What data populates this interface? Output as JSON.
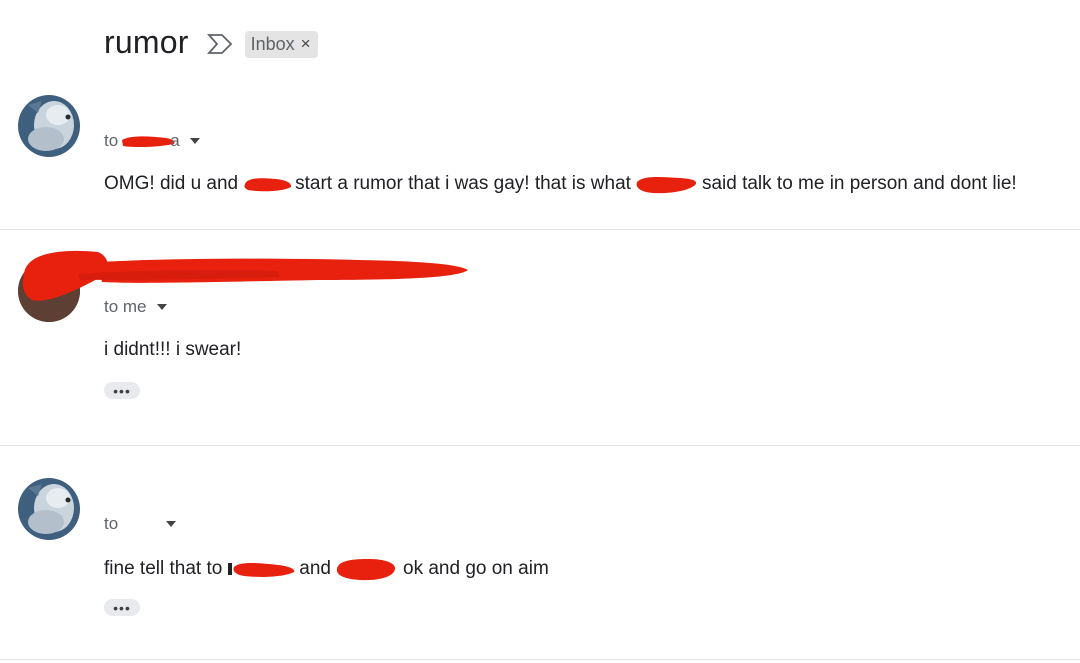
{
  "thread": {
    "subject": "rumor",
    "label": "Inbox",
    "label_close": "×",
    "important_icon": "important-marker-icon"
  },
  "messages": [
    {
      "sender": "",
      "to_prefix": "to",
      "recipient_visible": "a",
      "body_parts": [
        "OMG! did u and",
        "start a rumor that i was gay! that is what",
        "said talk to me in person and dont lie!"
      ],
      "show_ellipsis": false
    },
    {
      "sender": "",
      "to_prefix": "to me",
      "recipient_visible": "",
      "body_parts": [
        "i didnt!!! i swear!"
      ],
      "show_ellipsis": true,
      "ellipsis": "•••"
    },
    {
      "sender": "",
      "to_prefix": "to",
      "recipient_visible": "",
      "body_parts": [
        "fine tell that to",
        "and",
        "ok and go on aim"
      ],
      "show_ellipsis": true,
      "ellipsis": "•••"
    }
  ],
  "colors": {
    "redaction": "#e8210f",
    "label_bg": "#e4e4e4",
    "divider": "#e3e3e3"
  }
}
